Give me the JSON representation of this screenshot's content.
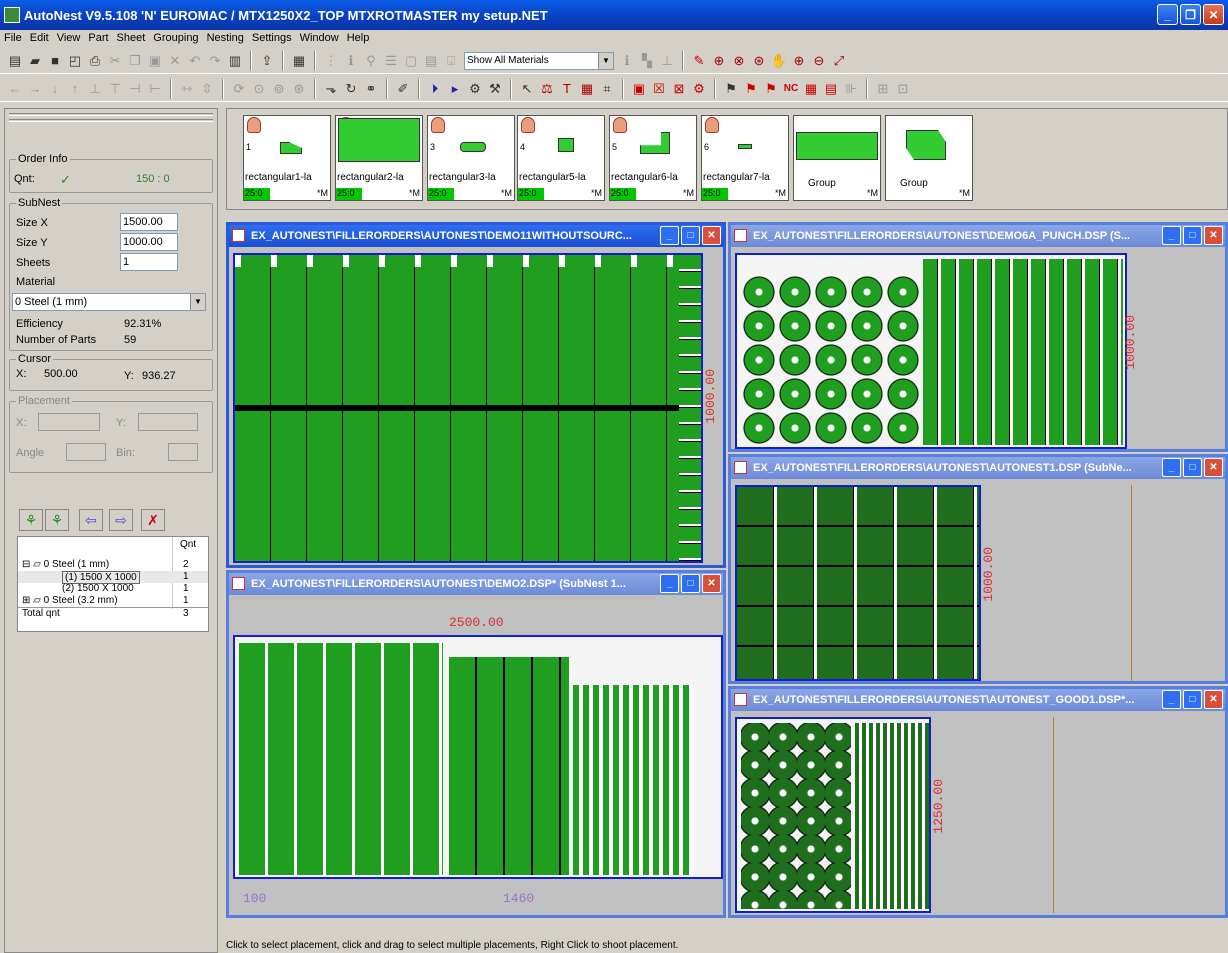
{
  "titlebar": {
    "title": "AutoNest V9.5.108 'N' EUROMAC / MTX1250X2_TOP MTXROTMASTER my setup.NET",
    "min": "_",
    "restore": "❐",
    "close": "✕"
  },
  "menu": [
    "File",
    "Edit",
    "View",
    "Part",
    "Sheet",
    "Grouping",
    "Nesting",
    "Settings",
    "Window",
    "Help"
  ],
  "toolbar": {
    "material_filter": "Show All Materials"
  },
  "order_info": {
    "label": "Order Info",
    "qnt_label": "Qnt:",
    "qnt_check": "✓",
    "qnt_value": "150 : 0"
  },
  "subnest": {
    "label": "SubNest",
    "sizex_label": "Size X",
    "sizex": "1500.00",
    "sizey_label": "Size Y",
    "sizey": "1000.00",
    "sheets_label": "Sheets",
    "sheets": "1",
    "material_label": "Material",
    "material": "0  Steel (1 mm)",
    "efficiency_label": "Efficiency",
    "efficiency": "92.31%",
    "parts_label": "Number of Parts",
    "parts": "59"
  },
  "cursor": {
    "label": "Cursor",
    "x_label": "X:",
    "x": "500.00",
    "y_label": "Y:",
    "y": "936.27"
  },
  "placement": {
    "label": "Placement",
    "x_label": "X:",
    "y_label": "Y:",
    "angle_label": "Angle",
    "bin_label": "Bin:"
  },
  "tree": {
    "header": "Qnt",
    "rows": [
      {
        "name": "⊟ ▱ 0  Steel (1 mm)",
        "qnt": "2"
      },
      {
        "name": "(1) 1500 X 1000",
        "qnt": "1"
      },
      {
        "name": "(2) 1500 X 1000",
        "qnt": "1"
      },
      {
        "name": "⊞ ▱ 0  Steel (3.2 mm)",
        "qnt": "1"
      },
      {
        "name": "Total qnt",
        "qnt": "3"
      }
    ]
  },
  "parts": [
    {
      "num": "1",
      "name": "rectangular1-la",
      "qty": "25:0",
      "m": "*M"
    },
    {
      "num": "2",
      "name": "rectangular2-la",
      "qty": "25:0",
      "m": "*M"
    },
    {
      "num": "3",
      "name": "rectangular3-la",
      "qty": "25:0",
      "m": "*M"
    },
    {
      "num": "4",
      "name": "rectangular5-la",
      "qty": "25:0",
      "m": "*M"
    },
    {
      "num": "5",
      "name": "rectangular6-la",
      "qty": "25:0",
      "m": "*M"
    },
    {
      "num": "6",
      "name": "rectangular7-la",
      "qty": "25:0",
      "m": "*M"
    },
    {
      "num": "",
      "name": "Group",
      "qty": "",
      "m": "*M"
    },
    {
      "num": "",
      "name": "Group",
      "qty": "",
      "m": "*M"
    }
  ],
  "windows": {
    "w1": {
      "title": "EX_AUTONEST\\FILLERORDERS\\AUTONEST\\DEMO11WITHOUTSOURC...",
      "dim_v": "1000.00"
    },
    "w2": {
      "title": "EX_AUTONEST\\FILLERORDERS\\AUTONEST\\DEMO6A_PUNCH.DSP (S...",
      "dim_v": "1000.00"
    },
    "w3": {
      "title": "EX_AUTONEST\\FILLERORDERS\\AUTONEST\\AUTONEST1.DSP (SubNe...",
      "dim_v": "1000.00"
    },
    "w4": {
      "title": "EX_AUTONEST\\FILLERORDERS\\AUTONEST\\DEMO2.DSP* (SubNest 1...",
      "dim_h": "2500.00",
      "dim_a": "100",
      "dim_b": "1460"
    },
    "w5": {
      "title": "EX_AUTONEST\\FILLERORDERS\\AUTONEST\\AUTONEST_GOOD1.DSP*...",
      "dim_v": "1250.00"
    }
  },
  "status": "Click to select placement, click and drag to select multiple placements, Right Click to shoot placement."
}
